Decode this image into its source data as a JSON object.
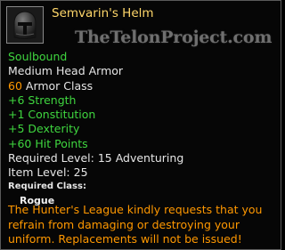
{
  "item": {
    "name": "Semvarin's Helm",
    "icon": "helmet-icon",
    "watermark": "TheTelonProject.com",
    "binding": "Soulbound",
    "slot_type": "Medium Head Armor",
    "armor_class_value": "60",
    "armor_class_label": "Armor Class",
    "stats": [
      "+6 Strength",
      "+1 Constitution",
      "+5 Dexterity",
      "+60 Hit Points"
    ],
    "required_level_label": "Required Level:",
    "required_level_value": "15 Adventuring",
    "item_level_label": "Item Level:",
    "item_level_value": "25",
    "required_class_label": "Required Class:",
    "required_class_value": "Rogue",
    "lore": "The Hunter's League kindly requests that you refrain from damaging or destroying your uniform. Replacements will not be issued!"
  },
  "colors": {
    "title": "#ffd76a",
    "stat_green": "#3fd63f",
    "accent_orange": "#ff9800",
    "text": "#e6e6e6"
  }
}
